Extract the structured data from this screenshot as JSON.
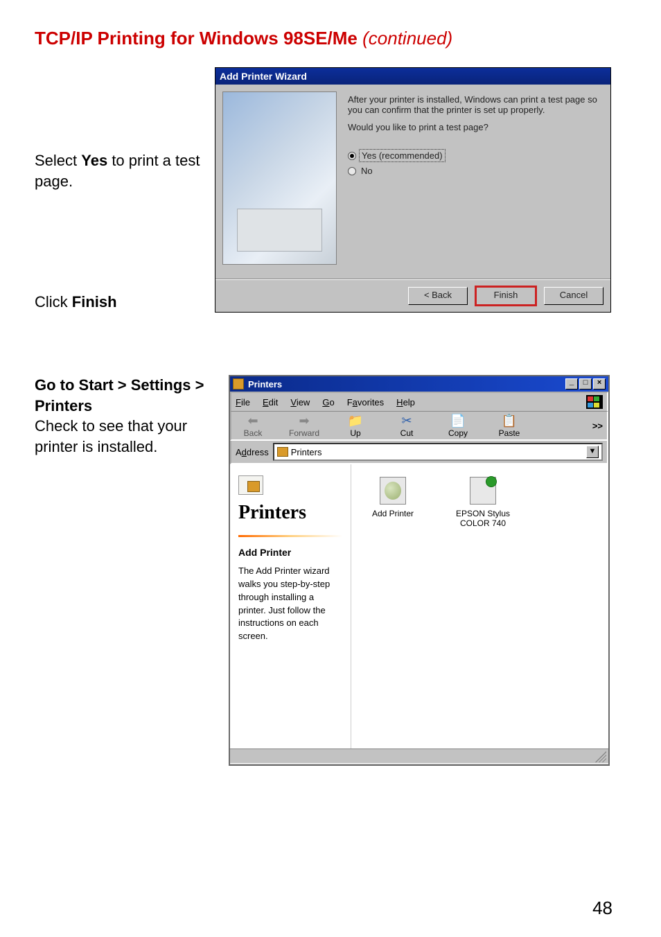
{
  "page": {
    "title_main": "TCP/IP Printing for Windows 98SE/Me",
    "title_suffix": " (continued)",
    "number": "48"
  },
  "instructions": {
    "step1_pre": "Select ",
    "step1_bold": "Yes",
    "step1_post": " to print a test page.",
    "step2_pre": "Click ",
    "step2_bold": "Finish",
    "step3_bold": "Go to Start > Settings > Printers",
    "step3_rest": "Check to see that your printer is installed."
  },
  "wizard": {
    "title": "Add Printer Wizard",
    "line1": "After your printer is installed, Windows can print a test page so you can confirm that the printer is set up properly.",
    "line2": "Would you like to print a test page?",
    "opt_yes": "Yes (recommended)",
    "opt_no": "No",
    "btn_back": "< Back",
    "btn_finish": "Finish",
    "btn_cancel": "Cancel"
  },
  "explorer": {
    "title": "Printers",
    "menus": {
      "file": "File",
      "edit": "Edit",
      "view": "View",
      "go": "Go",
      "favorites": "Favorites",
      "help": "Help"
    },
    "tools": {
      "back": "Back",
      "forward": "Forward",
      "up": "Up",
      "cut": "Cut",
      "copy": "Copy",
      "paste": "Paste",
      "more": ">>"
    },
    "address_label": "Address",
    "address_value": "Printers",
    "left_heading": "Printers",
    "left_sub": "Add Printer",
    "left_desc": "The Add Printer wizard walks you step-by-step through installing a printer. Just follow the instructions on each screen.",
    "items": {
      "add_printer": "Add Printer",
      "epson": "EPSON Stylus COLOR 740"
    }
  }
}
